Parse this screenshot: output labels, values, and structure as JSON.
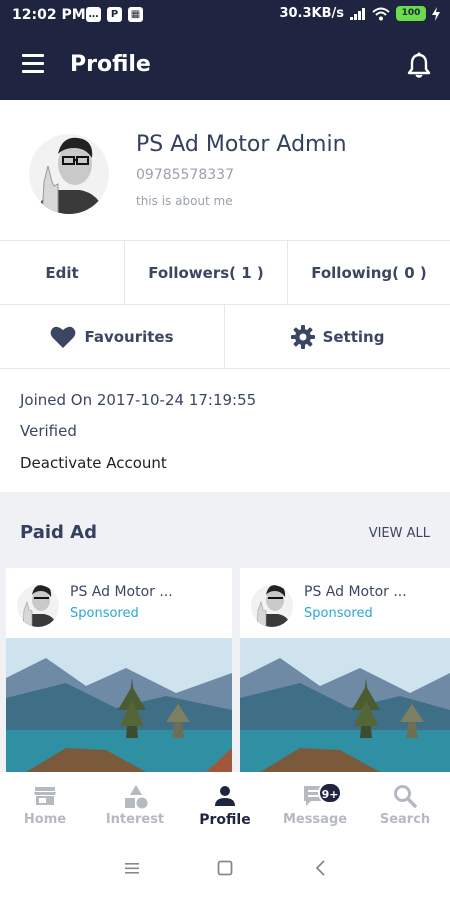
{
  "status": {
    "time": "12:02 PM",
    "speed": "30.3KB/s",
    "battery": "100"
  },
  "appbar": {
    "title": "Profile",
    "menu_icon": "hamburger-icon",
    "bell_icon": "bell-icon"
  },
  "profile": {
    "name": "PS Ad Motor Admin",
    "phone": "09785578337",
    "about": "this is about me"
  },
  "actions": {
    "edit": "Edit",
    "followers": "Followers( 1 )",
    "following": "Following( 0 )",
    "favourites": "Favourites",
    "setting": "Setting"
  },
  "info": {
    "joined": "Joined On 2017-10-24 17:19:55",
    "verified": "Verified",
    "deactivate": "Deactivate Account"
  },
  "paid_ad": {
    "title": "Paid Ad",
    "view_all": "VIEW ALL",
    "cards": [
      {
        "name": "PS Ad Motor ...",
        "sponsored": "Sponsored"
      },
      {
        "name": "PS Ad Motor ...",
        "sponsored": "Sponsored"
      }
    ]
  },
  "bottom_nav": {
    "items": [
      {
        "label": "Home",
        "icon": "store-icon"
      },
      {
        "label": "Interest",
        "icon": "shapes-icon"
      },
      {
        "label": "Profile",
        "icon": "person-icon"
      },
      {
        "label": "Message",
        "icon": "message-icon",
        "badge": "9+"
      },
      {
        "label": "Search",
        "icon": "search-icon"
      }
    ],
    "active": "Profile"
  },
  "colors": {
    "appbar": "#1f2540",
    "accent": "#2aa7d6",
    "text": "#3b4663"
  }
}
